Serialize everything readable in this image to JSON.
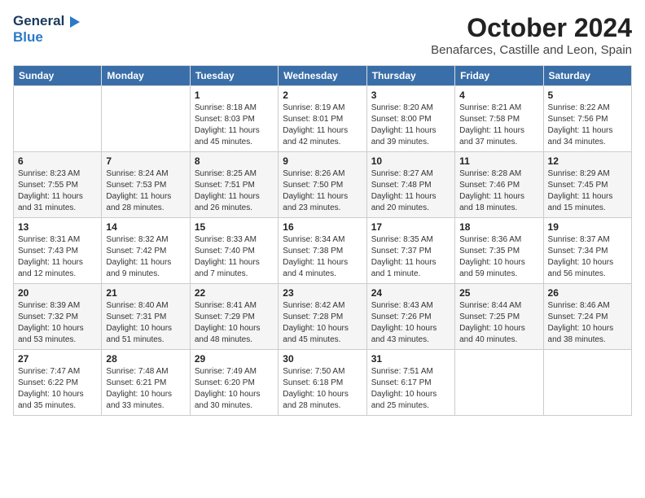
{
  "header": {
    "logo_general": "General",
    "logo_blue": "Blue",
    "month": "October 2024",
    "location": "Benafarces, Castille and Leon, Spain"
  },
  "weekdays": [
    "Sunday",
    "Monday",
    "Tuesday",
    "Wednesday",
    "Thursday",
    "Friday",
    "Saturday"
  ],
  "weeks": [
    [
      {
        "day": "",
        "info": ""
      },
      {
        "day": "",
        "info": ""
      },
      {
        "day": "1",
        "info": "Sunrise: 8:18 AM\nSunset: 8:03 PM\nDaylight: 11 hours and 45 minutes."
      },
      {
        "day": "2",
        "info": "Sunrise: 8:19 AM\nSunset: 8:01 PM\nDaylight: 11 hours and 42 minutes."
      },
      {
        "day": "3",
        "info": "Sunrise: 8:20 AM\nSunset: 8:00 PM\nDaylight: 11 hours and 39 minutes."
      },
      {
        "day": "4",
        "info": "Sunrise: 8:21 AM\nSunset: 7:58 PM\nDaylight: 11 hours and 37 minutes."
      },
      {
        "day": "5",
        "info": "Sunrise: 8:22 AM\nSunset: 7:56 PM\nDaylight: 11 hours and 34 minutes."
      }
    ],
    [
      {
        "day": "6",
        "info": "Sunrise: 8:23 AM\nSunset: 7:55 PM\nDaylight: 11 hours and 31 minutes."
      },
      {
        "day": "7",
        "info": "Sunrise: 8:24 AM\nSunset: 7:53 PM\nDaylight: 11 hours and 28 minutes."
      },
      {
        "day": "8",
        "info": "Sunrise: 8:25 AM\nSunset: 7:51 PM\nDaylight: 11 hours and 26 minutes."
      },
      {
        "day": "9",
        "info": "Sunrise: 8:26 AM\nSunset: 7:50 PM\nDaylight: 11 hours and 23 minutes."
      },
      {
        "day": "10",
        "info": "Sunrise: 8:27 AM\nSunset: 7:48 PM\nDaylight: 11 hours and 20 minutes."
      },
      {
        "day": "11",
        "info": "Sunrise: 8:28 AM\nSunset: 7:46 PM\nDaylight: 11 hours and 18 minutes."
      },
      {
        "day": "12",
        "info": "Sunrise: 8:29 AM\nSunset: 7:45 PM\nDaylight: 11 hours and 15 minutes."
      }
    ],
    [
      {
        "day": "13",
        "info": "Sunrise: 8:31 AM\nSunset: 7:43 PM\nDaylight: 11 hours and 12 minutes."
      },
      {
        "day": "14",
        "info": "Sunrise: 8:32 AM\nSunset: 7:42 PM\nDaylight: 11 hours and 9 minutes."
      },
      {
        "day": "15",
        "info": "Sunrise: 8:33 AM\nSunset: 7:40 PM\nDaylight: 11 hours and 7 minutes."
      },
      {
        "day": "16",
        "info": "Sunrise: 8:34 AM\nSunset: 7:38 PM\nDaylight: 11 hours and 4 minutes."
      },
      {
        "day": "17",
        "info": "Sunrise: 8:35 AM\nSunset: 7:37 PM\nDaylight: 11 hours and 1 minute."
      },
      {
        "day": "18",
        "info": "Sunrise: 8:36 AM\nSunset: 7:35 PM\nDaylight: 10 hours and 59 minutes."
      },
      {
        "day": "19",
        "info": "Sunrise: 8:37 AM\nSunset: 7:34 PM\nDaylight: 10 hours and 56 minutes."
      }
    ],
    [
      {
        "day": "20",
        "info": "Sunrise: 8:39 AM\nSunset: 7:32 PM\nDaylight: 10 hours and 53 minutes."
      },
      {
        "day": "21",
        "info": "Sunrise: 8:40 AM\nSunset: 7:31 PM\nDaylight: 10 hours and 51 minutes."
      },
      {
        "day": "22",
        "info": "Sunrise: 8:41 AM\nSunset: 7:29 PM\nDaylight: 10 hours and 48 minutes."
      },
      {
        "day": "23",
        "info": "Sunrise: 8:42 AM\nSunset: 7:28 PM\nDaylight: 10 hours and 45 minutes."
      },
      {
        "day": "24",
        "info": "Sunrise: 8:43 AM\nSunset: 7:26 PM\nDaylight: 10 hours and 43 minutes."
      },
      {
        "day": "25",
        "info": "Sunrise: 8:44 AM\nSunset: 7:25 PM\nDaylight: 10 hours and 40 minutes."
      },
      {
        "day": "26",
        "info": "Sunrise: 8:46 AM\nSunset: 7:24 PM\nDaylight: 10 hours and 38 minutes."
      }
    ],
    [
      {
        "day": "27",
        "info": "Sunrise: 7:47 AM\nSunset: 6:22 PM\nDaylight: 10 hours and 35 minutes."
      },
      {
        "day": "28",
        "info": "Sunrise: 7:48 AM\nSunset: 6:21 PM\nDaylight: 10 hours and 33 minutes."
      },
      {
        "day": "29",
        "info": "Sunrise: 7:49 AM\nSunset: 6:20 PM\nDaylight: 10 hours and 30 minutes."
      },
      {
        "day": "30",
        "info": "Sunrise: 7:50 AM\nSunset: 6:18 PM\nDaylight: 10 hours and 28 minutes."
      },
      {
        "day": "31",
        "info": "Sunrise: 7:51 AM\nSunset: 6:17 PM\nDaylight: 10 hours and 25 minutes."
      },
      {
        "day": "",
        "info": ""
      },
      {
        "day": "",
        "info": ""
      }
    ]
  ]
}
